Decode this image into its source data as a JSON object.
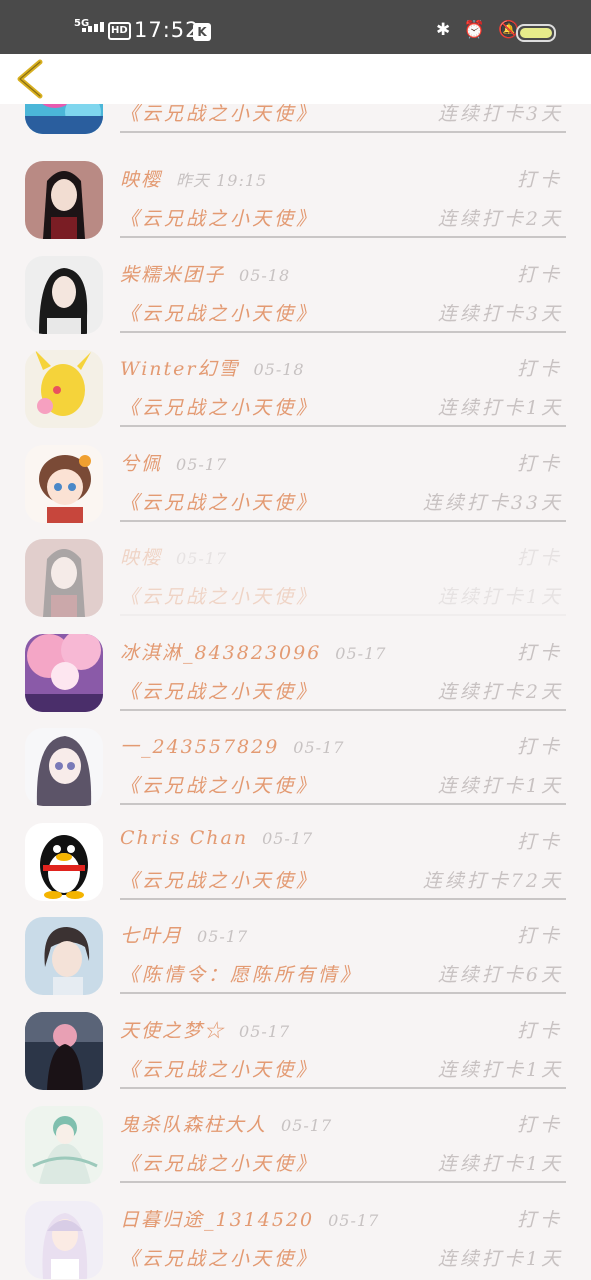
{
  "status_bar": {
    "network": "5G",
    "hd": "HD",
    "time": "17:52",
    "app_badge": "K",
    "right_icons": "✱ ⏰ 🔕",
    "battery_icon": "battery-icon"
  },
  "header": {
    "back_icon": "back-chevron-icon"
  },
  "colors": {
    "name": "#e39a72",
    "muted": "#c8c2c2",
    "background": "#f7f4f4",
    "back": "#d8b021"
  },
  "rows": [
    {
      "name": "",
      "date": "",
      "punch": "",
      "book": "《云兄战之小天使》",
      "streak": "连续打卡3天"
    },
    {
      "name": "映樱",
      "date": "昨天 19:15",
      "punch": "打卡",
      "book": "《云兄战之小天使》",
      "streak": "连续打卡2天"
    },
    {
      "name": "柴糯米团子",
      "date": "05-18",
      "punch": "打卡",
      "book": "《云兄战之小天使》",
      "streak": "连续打卡3天"
    },
    {
      "name": "Winter幻雪",
      "date": "05-18",
      "punch": "打卡",
      "book": "《云兄战之小天使》",
      "streak": "连续打卡1天"
    },
    {
      "name": "兮佩",
      "date": "05-17",
      "punch": "打卡",
      "book": "《云兄战之小天使》",
      "streak": "连续打卡33天"
    },
    {
      "name": "映樱",
      "date": "05-17",
      "punch": "打卡",
      "book": "《云兄战之小天使》",
      "streak": "连续打卡1天"
    },
    {
      "name": "冰淇淋_843823096",
      "date": "05-17",
      "punch": "打卡",
      "book": "《云兄战之小天使》",
      "streak": "连续打卡2天"
    },
    {
      "name": "一_243557829",
      "date": "05-17",
      "punch": "打卡",
      "book": "《云兄战之小天使》",
      "streak": "连续打卡1天"
    },
    {
      "name": "Chris Chan",
      "date": "05-17",
      "punch": "打卡",
      "book": "《云兄战之小天使》",
      "streak": "连续打卡72天"
    },
    {
      "name": "七叶月",
      "date": "05-17",
      "punch": "打卡",
      "book": "《陈情令：愿陈所有情》",
      "streak": "连续打卡6天"
    },
    {
      "name": "天使之梦☆",
      "date": "05-17",
      "punch": "打卡",
      "book": "《云兄战之小天使》",
      "streak": "连续打卡1天"
    },
    {
      "name": "鬼杀队森柱大人",
      "date": "05-17",
      "punch": "打卡",
      "book": "《云兄战之小天使》",
      "streak": "连续打卡1天"
    },
    {
      "name": "日暮归途_1314520",
      "date": "05-17",
      "punch": "打卡",
      "book": "《云兄战之小天使》",
      "streak": "连续打卡1天"
    }
  ]
}
